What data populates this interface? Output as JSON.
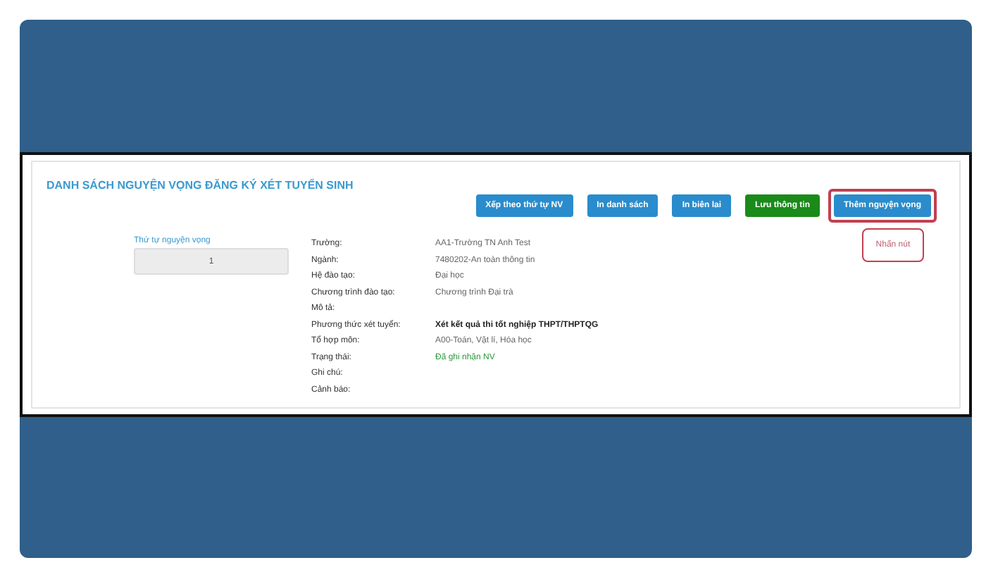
{
  "title": "DANH SÁCH NGUYỆN VỌNG ĐĂNG KÝ XÉT TUYỂN SINH",
  "buttons": [
    {
      "label": "Xếp theo thứ tự NV",
      "kind": "primary",
      "highlighted": false
    },
    {
      "label": "In danh sách",
      "kind": "primary",
      "highlighted": false
    },
    {
      "label": "In biên lai",
      "kind": "primary",
      "highlighted": false
    },
    {
      "label": "Lưu thông tin",
      "kind": "success",
      "highlighted": false
    },
    {
      "label": "Thêm nguyện vọng",
      "kind": "primary",
      "highlighted": true
    }
  ],
  "callout": {
    "text": "Nhấn nút"
  },
  "order": {
    "label": "Thứ tự nguyện vọng",
    "value": "1"
  },
  "fields": [
    {
      "label": "Trường:",
      "value": "AA1-Trường TN Anh Test",
      "kind": "plain"
    },
    {
      "label": "Ngành:",
      "value": "7480202-An toàn thông tin",
      "kind": "plain"
    },
    {
      "label": "Hệ đào tạo:",
      "value": "Đại học",
      "kind": "plain"
    },
    {
      "label": "Chương trình đào tạo:",
      "value": "Chương trình Đại trà",
      "kind": "plain"
    },
    {
      "label": "Mô tả:"
    },
    {
      "label": "Phương thức xét tuyển:",
      "value": "Xét kết quả thi tốt nghiệp THPT/THPTQG",
      "kind": "bold"
    },
    {
      "label": "Tổ hợp môn:",
      "value": "A00-Toán, Vật lí, Hóa học",
      "kind": "plain"
    },
    {
      "label": "Trạng thái:",
      "value": "Đã ghi nhận NV",
      "kind": "status"
    },
    {
      "label": "Ghi chú:"
    },
    {
      "label": "Cảnh báo:"
    }
  ]
}
